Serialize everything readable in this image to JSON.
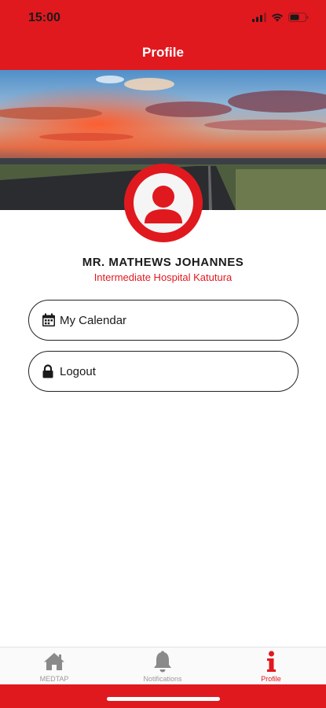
{
  "status_bar": {
    "time": "15:00"
  },
  "header": {
    "title": "Profile"
  },
  "profile": {
    "name": "MR. MATHEWS JOHANNES",
    "organization": "Intermediate Hospital Katutura"
  },
  "menu": [
    {
      "label": "My Calendar",
      "icon": "calendar-icon"
    },
    {
      "label": "Logout",
      "icon": "lock-icon"
    }
  ],
  "tabs": [
    {
      "label": "MEDTAP",
      "icon": "home-icon",
      "active": false
    },
    {
      "label": "Notifications",
      "icon": "bell-icon",
      "active": false
    },
    {
      "label": "Profile",
      "icon": "info-icon",
      "active": true
    }
  ],
  "colors": {
    "accent": "#e0191f",
    "inactive_tab": "#9a9a9a",
    "text": "#1a1a1a"
  }
}
